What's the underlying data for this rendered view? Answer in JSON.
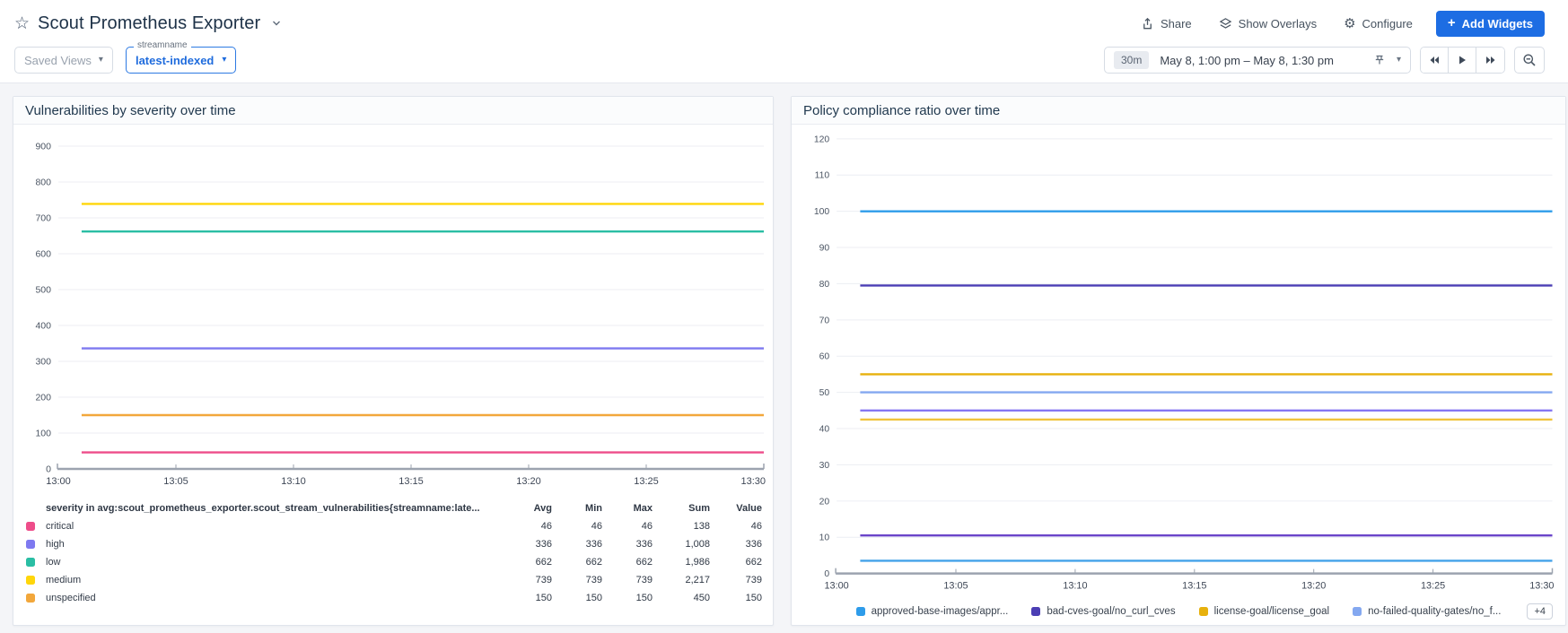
{
  "header": {
    "title": "Scout Prometheus Exporter",
    "actions": {
      "share": "Share",
      "show_overlays": "Show Overlays",
      "configure": "Configure",
      "add_widgets": "Add Widgets",
      "add_widgets_plus": "+"
    },
    "saved_views_label": "Saved Views",
    "stream_filter": {
      "label": "streamname",
      "value": "latest-indexed"
    },
    "time_range": {
      "badge": "30m",
      "text": "May 8, 1:00 pm – May 8, 1:30 pm"
    },
    "accent_color": "#1d6de3"
  },
  "chart_data": [
    {
      "type": "line",
      "title": "Vulnerabilities by severity over time",
      "x": [
        "13:00",
        "13:05",
        "13:10",
        "13:15",
        "13:20",
        "13:25",
        "13:30"
      ],
      "ylim": [
        0,
        900
      ],
      "y_tick_step": 100,
      "grid": true,
      "note": "all series are constant (flat lines) from ~13:01 to 13:30",
      "series": [
        {
          "name": "critical",
          "color": "#EE4D8A",
          "y": 46
        },
        {
          "name": "high",
          "color": "#7E79F0",
          "y": 336
        },
        {
          "name": "low",
          "color": "#2ABEA4",
          "y": 662
        },
        {
          "name": "medium",
          "color": "#FFD60A",
          "y": 739
        },
        {
          "name": "unspecified",
          "color": "#F2A73B",
          "y": 150
        }
      ],
      "summary_table": {
        "query": "severity in avg:scout_prometheus_exporter.scout_stream_vulnerabilities{streamname:late...",
        "columns": [
          "Avg",
          "Min",
          "Max",
          "Sum",
          "Value"
        ],
        "rows": [
          {
            "name": "critical",
            "color": "#EE4D8A",
            "cells": [
              "46",
              "46",
              "46",
              "138",
              "46"
            ]
          },
          {
            "name": "high",
            "color": "#7E79F0",
            "cells": [
              "336",
              "336",
              "336",
              "1,008",
              "336"
            ]
          },
          {
            "name": "low",
            "color": "#2ABEA4",
            "cells": [
              "662",
              "662",
              "662",
              "1,986",
              "662"
            ]
          },
          {
            "name": "medium",
            "color": "#FFD60A",
            "cells": [
              "739",
              "739",
              "739",
              "2,217",
              "739"
            ]
          },
          {
            "name": "unspecified",
            "color": "#F2A73B",
            "cells": [
              "150",
              "150",
              "150",
              "450",
              "150"
            ]
          }
        ]
      }
    },
    {
      "type": "line",
      "title": "Policy compliance ratio over time",
      "x": [
        "13:00",
        "13:05",
        "13:10",
        "13:15",
        "13:20",
        "13:25",
        "13:30"
      ],
      "ylim": [
        0,
        120
      ],
      "y_tick_step": 10,
      "grid": true,
      "note": "all series are constant (flat lines) from ~13:01 to 13:30; 4 additional series collapsed under +4",
      "series": [
        {
          "name": "approved-base-images/appr...",
          "color": "#2E9CEA",
          "y": 100
        },
        {
          "name": "bad-cves-goal/no_curl_cves",
          "color": "#4B3EB4",
          "y": 79.5
        },
        {
          "name": "license-goal/license_goal",
          "color": "#E7B10D",
          "y": 55
        },
        {
          "name": "no-failed-quality-gates/no_f...",
          "color": "#84A8F0",
          "y": 50
        },
        {
          "name": "",
          "color": "#8577F2",
          "y": 45
        },
        {
          "name": "",
          "color": "#F0C43C",
          "y": 42.5
        },
        {
          "name": "",
          "color": "#6A44C9",
          "y": 10.5
        },
        {
          "name": "",
          "color": "#43A2E9",
          "y": 3.5
        }
      ],
      "legend_more": "+4"
    }
  ]
}
